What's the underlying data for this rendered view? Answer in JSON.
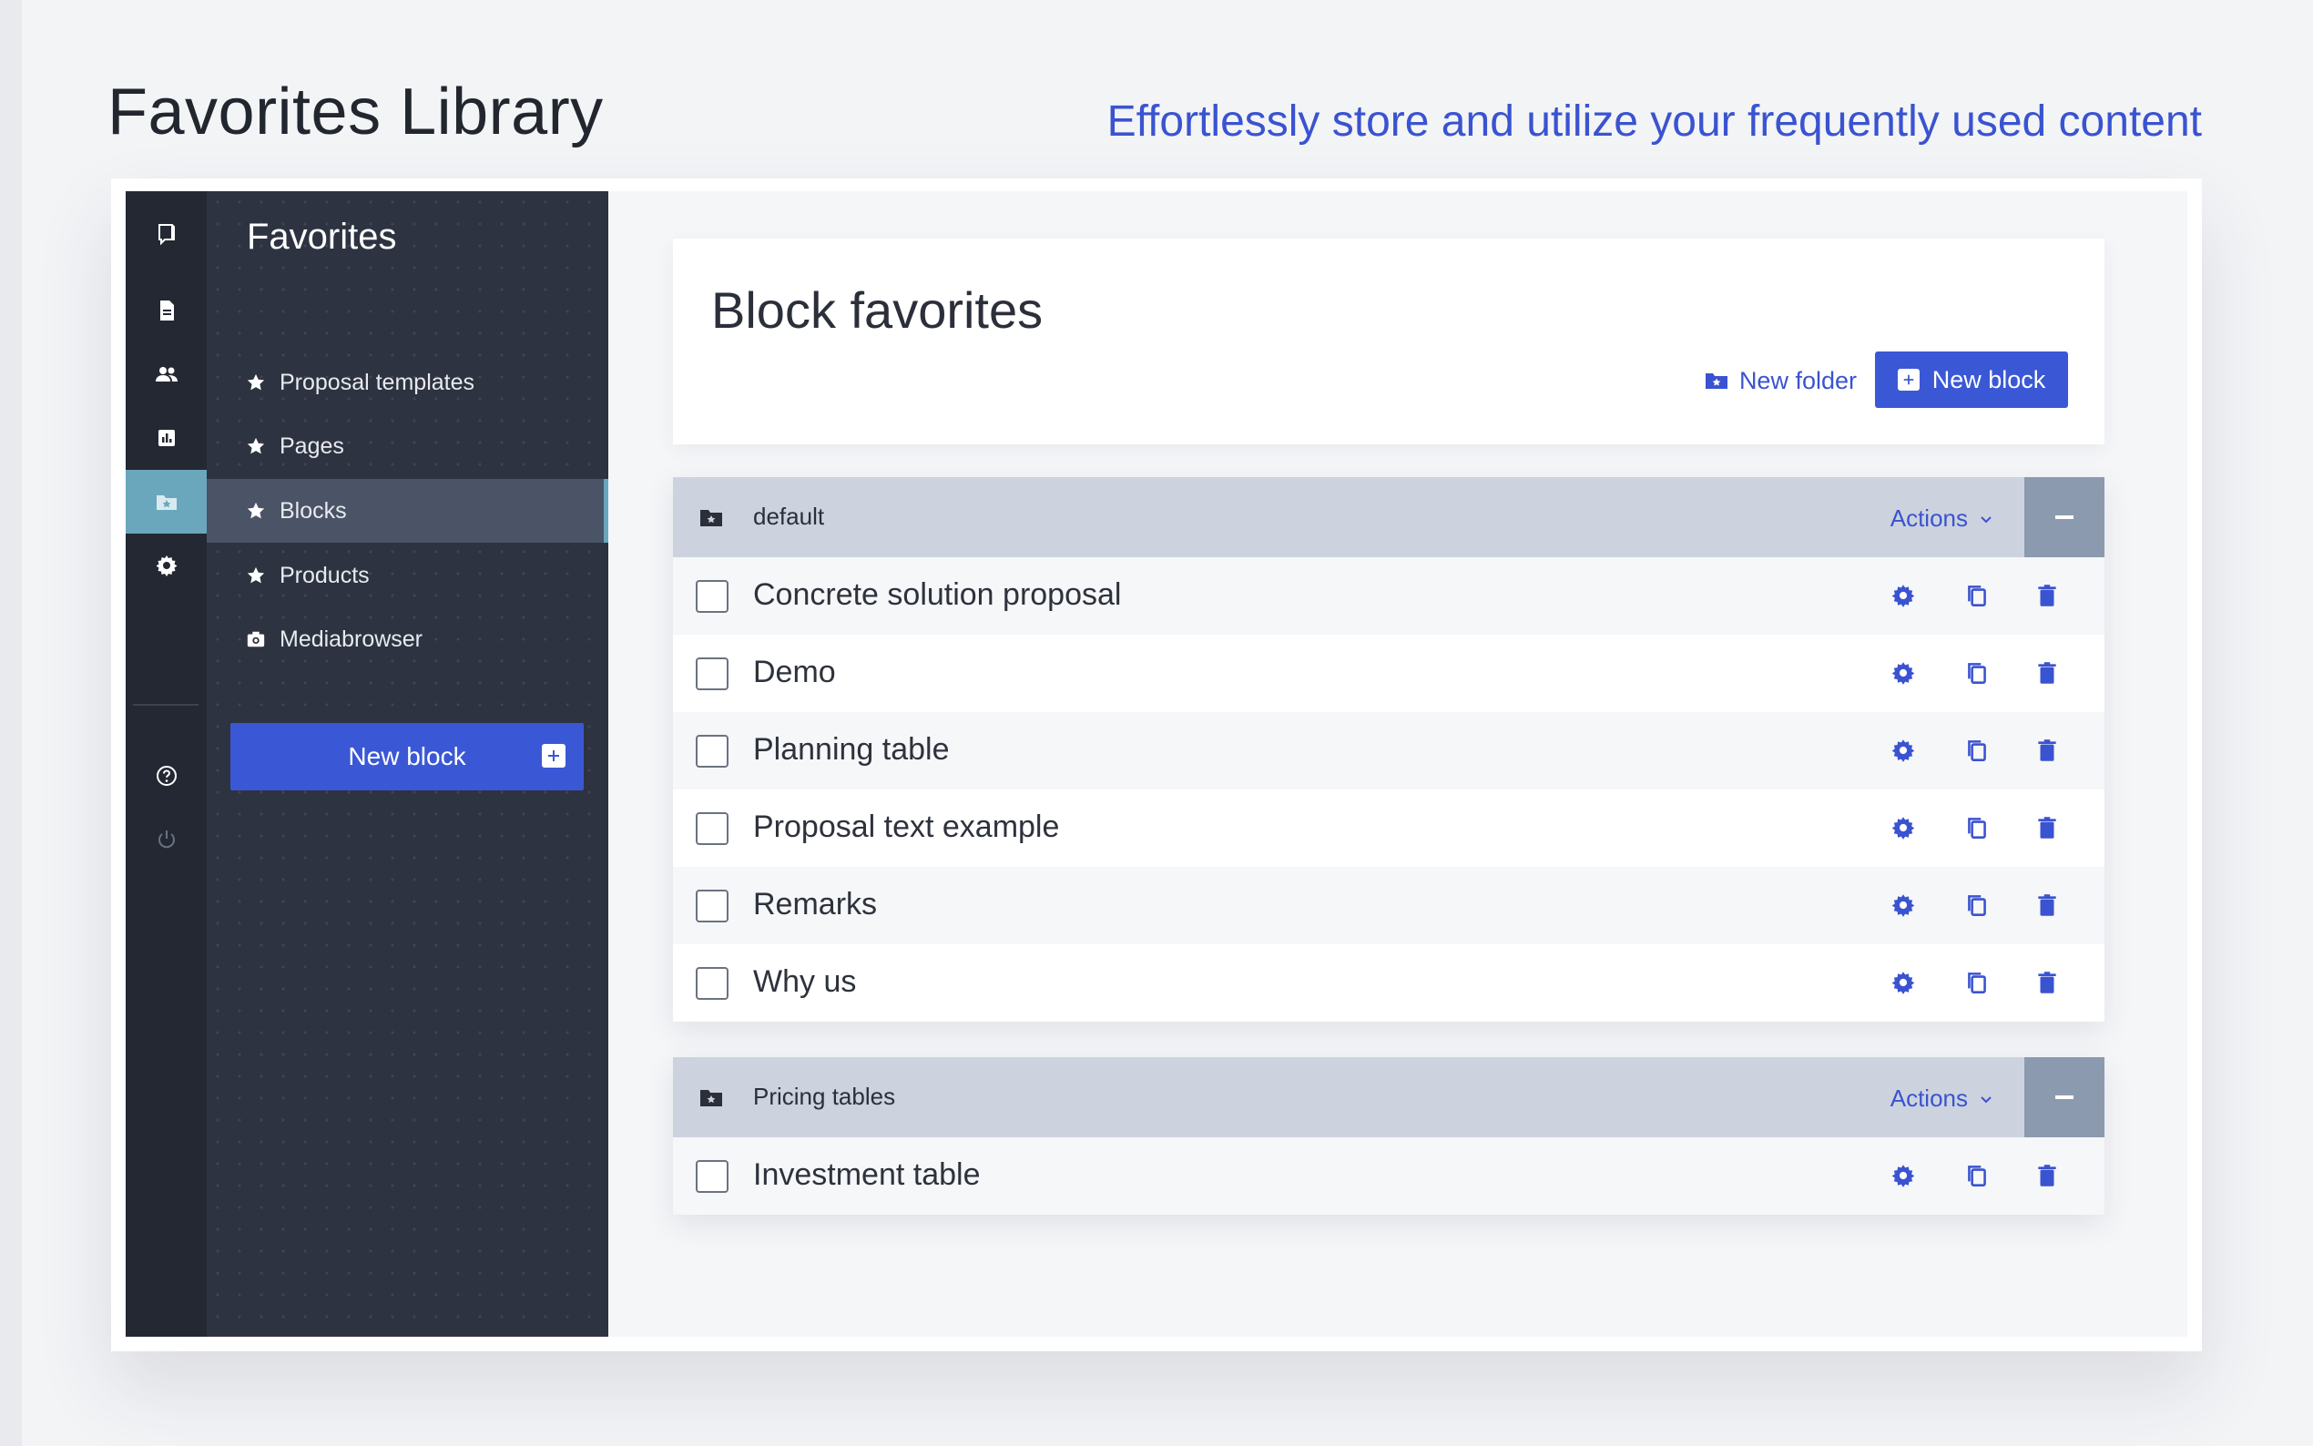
{
  "hero": {
    "title": "Favorites Library",
    "subtitle": "Effortlessly store and utilize your frequently used content"
  },
  "rail": {
    "items": [
      {
        "icon": "logo-icon"
      },
      {
        "icon": "document-icon"
      },
      {
        "icon": "users-icon"
      },
      {
        "icon": "chart-icon"
      },
      {
        "icon": "favorites-folder-icon",
        "active": true
      },
      {
        "icon": "gear-icon"
      },
      {
        "icon": "help-icon"
      },
      {
        "icon": "power-icon"
      }
    ]
  },
  "sidebar": {
    "title": "Favorites",
    "items": [
      {
        "label": "Proposal templates",
        "icon": "star-icon"
      },
      {
        "label": "Pages",
        "icon": "star-icon"
      },
      {
        "label": "Blocks",
        "icon": "star-icon",
        "active": true
      },
      {
        "label": "Products",
        "icon": "star-icon"
      },
      {
        "label": "Mediabrowser",
        "icon": "camera-icon"
      }
    ],
    "new_block_label": "New block"
  },
  "main": {
    "title": "Block favorites",
    "new_folder_label": "New folder",
    "new_block_label": "New block"
  },
  "folders": [
    {
      "name": "default",
      "actions_label": "Actions",
      "items": [
        "Concrete solution proposal",
        "Demo",
        "Planning table",
        "Proposal text example",
        "Remarks",
        "Why us"
      ]
    },
    {
      "name": "Pricing tables",
      "actions_label": "Actions",
      "items": [
        "Investment table"
      ]
    }
  ],
  "colors": {
    "accent": "#3a58d6",
    "rail_active": "#6aa7bc",
    "sidebar_bg": "#2d3340",
    "folder_header": "#ccd3de"
  }
}
